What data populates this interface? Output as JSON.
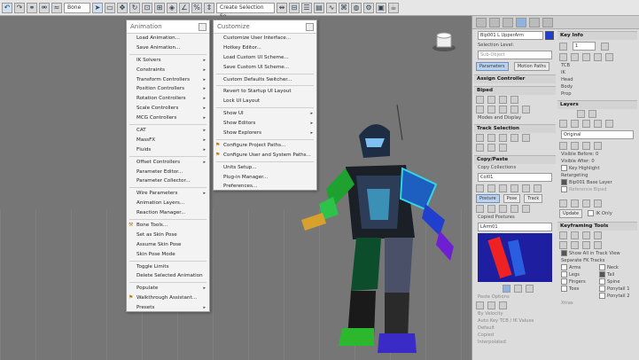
{
  "toolbar": {
    "filter_value": "Bone",
    "selection_set": "Create Selection Se",
    "icons": [
      "undo-icon",
      "redo-icon",
      "link-icon",
      "unlink-icon",
      "bind-icon",
      "select-icon",
      "rect-select-icon",
      "move-icon",
      "rotate-icon",
      "scale-icon",
      "snap-icon",
      "render-icon"
    ]
  },
  "menu_animation": {
    "title": "Animation",
    "items": [
      {
        "label": "Load Animation...",
        "arrow": ""
      },
      {
        "label": "Save Animation...",
        "arrow": ""
      },
      {
        "label": "IK Solvers",
        "arrow": "▸"
      },
      {
        "label": "Constraints",
        "arrow": "▸"
      },
      {
        "label": "Transform Controllers",
        "arrow": "▸"
      },
      {
        "label": "Position Controllers",
        "arrow": "▸"
      },
      {
        "label": "Rotation Controllers",
        "arrow": "▸"
      },
      {
        "label": "Scale Controllers",
        "arrow": "▸"
      },
      {
        "label": "MCG Controllers",
        "arrow": "▸"
      },
      {
        "label": "CAT",
        "arrow": "▸"
      },
      {
        "label": "MassFX",
        "arrow": "▸"
      },
      {
        "label": "Fluids",
        "arrow": "▸"
      },
      {
        "label": "Offset Controllers",
        "arrow": "▸"
      },
      {
        "label": "Parameter Editor...",
        "arrow": ""
      },
      {
        "label": "Parameter Collector...",
        "arrow": ""
      },
      {
        "label": "Wire Parameters",
        "arrow": "▸"
      },
      {
        "label": "Animation Layers...",
        "arrow": ""
      },
      {
        "label": "Reaction Manager...",
        "arrow": ""
      },
      {
        "label": "Bone Tools...",
        "arrow": ""
      },
      {
        "label": "Set as Skin Pose",
        "arrow": ""
      },
      {
        "label": "Assume Skin Pose",
        "arrow": ""
      },
      {
        "label": "Skin Pose Mode",
        "arrow": ""
      },
      {
        "label": "Toggle Limits",
        "arrow": ""
      },
      {
        "label": "Delete Selected Animation",
        "arrow": ""
      },
      {
        "label": "Populate",
        "arrow": "▸"
      },
      {
        "label": "Walkthrough Assistant...",
        "arrow": ""
      },
      {
        "label": "Presets",
        "arrow": "▸"
      }
    ]
  },
  "menu_customize": {
    "title": "Customize",
    "items": [
      {
        "label": "Customize User Interface...",
        "arrow": ""
      },
      {
        "label": "Hotkey Editor...",
        "arrow": ""
      },
      {
        "label": "Load Custom UI Scheme...",
        "arrow": ""
      },
      {
        "label": "Save Custom UI Scheme...",
        "arrow": ""
      },
      {
        "label": "Custom Defaults Switcher...",
        "arrow": ""
      },
      {
        "label": "Revert to Startup UI Layout",
        "arrow": ""
      },
      {
        "label": "Lock UI Layout",
        "arrow": ""
      },
      {
        "label": "Show UI",
        "arrow": "▸"
      },
      {
        "label": "Show Editors",
        "arrow": "▸"
      },
      {
        "label": "Show Explorers",
        "arrow": "▸"
      },
      {
        "label": "Configure Project Paths...",
        "arrow": ""
      },
      {
        "label": "Configure User and System Paths...",
        "arrow": ""
      },
      {
        "label": "Units Setup...",
        "arrow": ""
      },
      {
        "label": "Plug-in Manager...",
        "arrow": ""
      },
      {
        "label": "Preferences...",
        "arrow": ""
      }
    ]
  },
  "command_panel": {
    "object_name": "Bip001 L UpperArm",
    "selection_level": "Selection Level:",
    "sub_object": "Sub-Object",
    "parameters_btn": "Parameters",
    "motion_paths_btn": "Motion Paths",
    "assign_controller": "Assign Controller",
    "biped": "Biped",
    "modes_display": "Modes and Display",
    "track_selection": "Track Selection",
    "copy_paste": "Copy/Paste",
    "copy_collections": "Copy Collections",
    "collection_value": "Col01",
    "posture_btn": "Posture",
    "pose_btn": "Pose",
    "track_btn": "Track",
    "copied_postures": "Copied Postures",
    "posture_value": "LArm01",
    "paste_options": "Paste Options",
    "by_velocity": "By Velocity",
    "auto_key": "Auto Key TCB / IK Values",
    "default_label": "Default",
    "copied_label": "Copied",
    "interpolated_label": "Interpolated"
  },
  "key_panel": {
    "key_info": "Key Info",
    "key_number": "1",
    "tcb": "TCB",
    "ik": "IK",
    "head": "Head",
    "body": "Body",
    "prop": "Prop",
    "layers": "Layers",
    "layer_value": "Original",
    "visible_before": "Visible Before:",
    "visible_before_val": "0",
    "visible_after": "Visible After:",
    "visible_after_val": "0",
    "key_highlight": "Key Highlight",
    "retargeting": "Retargeting",
    "base_layer": "Bip001 Base Layer",
    "reference_biped": "Reference Biped",
    "update_btn": "Update",
    "ik_only": "IK Only",
    "keyframing_tools": "Keyframing Tools",
    "show_all_track": "Show All in Track View",
    "separate_fk": "Separate FK Tracks",
    "fk_tracks": [
      "Arms",
      "Neck",
      "Legs",
      "Tail",
      "Fingers",
      "Spine",
      "Toes",
      "Ponytail 1",
      "",
      "Ponytail 2"
    ],
    "xtras": "Xtras"
  },
  "colors": {
    "menu_bg": "#f3f3f3",
    "viewport_bg": "#767676",
    "panel_bg": "#dcdcdc",
    "accent_blue": "#bcd3ef",
    "selection_cyan": "#33d6e6"
  }
}
